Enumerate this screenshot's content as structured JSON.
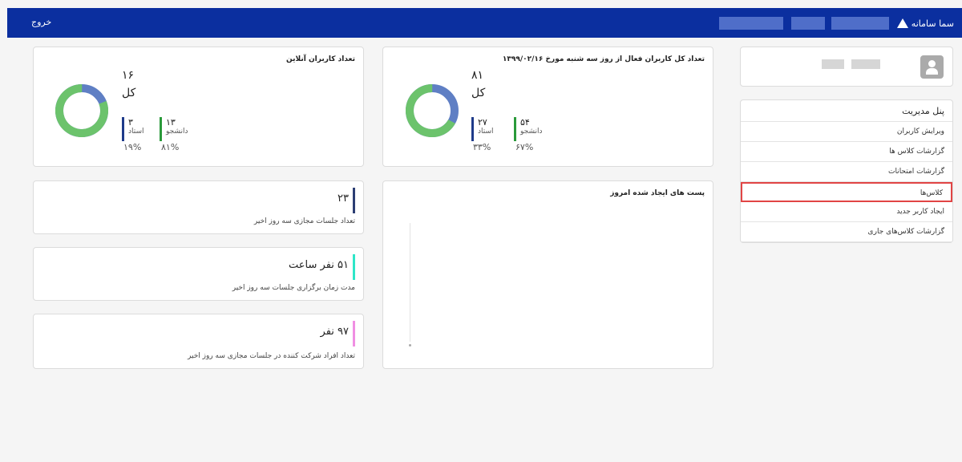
{
  "header": {
    "logout": "خروج",
    "logo_text": "سما سامانه"
  },
  "profile": {
    "avatar": "user-avatar-icon"
  },
  "menu": {
    "title": "پنل مدیریت",
    "items": [
      "ویرایش کاربران",
      "گزارشات کلاس ها",
      "گزارشات امتحانات",
      "کلاس‌ها",
      "ایجاد کاربر جدید",
      "گزارشات کلاس‌های جاری"
    ],
    "selected_index": 3
  },
  "online_users": {
    "title": "تعداد کاربران آنلاین",
    "total": "۱۶",
    "total_label": "کل",
    "students": {
      "value": "۱۳",
      "label": "دانشجو",
      "percent": "۸۱%"
    },
    "teachers": {
      "value": "۳",
      "label": "استاد",
      "percent": "۱۹%"
    },
    "student_fraction": 0.81,
    "colors": {
      "students": "#6cc36c",
      "teachers": "#5f7fc4"
    }
  },
  "active_users": {
    "title": "تعداد کل کاربران فعال از روز سه شنبه مورخ ۱۳۹۹/۰۲/۱۶",
    "total": "۸۱",
    "total_label": "کل",
    "students": {
      "value": "۵۴",
      "label": "دانشجو",
      "percent": "۶۷%"
    },
    "teachers": {
      "value": "۲۷",
      "label": "استاد",
      "percent": "۳۳%"
    },
    "student_fraction": 0.67,
    "colors": {
      "students": "#6cc36c",
      "teachers": "#5f7fc4"
    }
  },
  "posts_today": {
    "title": "پست های ایجاد شده امروز"
  },
  "metrics": [
    {
      "value": "۲۳",
      "label": "تعداد جلسات مجازی سه روز اخیر",
      "color": "#2c3e73"
    },
    {
      "value": "۵۱ نفر ساعت",
      "label": "مدت زمان برگزاری جلسات سه روز اخیر",
      "color": "#2ee6c8"
    },
    {
      "value": "۹۷ نفر",
      "label": "تعداد افراد شرکت کننده در جلسات مجازی سه روز اخیر",
      "color": "#f08fe3"
    }
  ],
  "colors": {
    "header": "#0b2f9f",
    "student_bar": "#2a9a3a",
    "teacher_bar": "#1f3b8a",
    "selected_border": "#e14545"
  }
}
